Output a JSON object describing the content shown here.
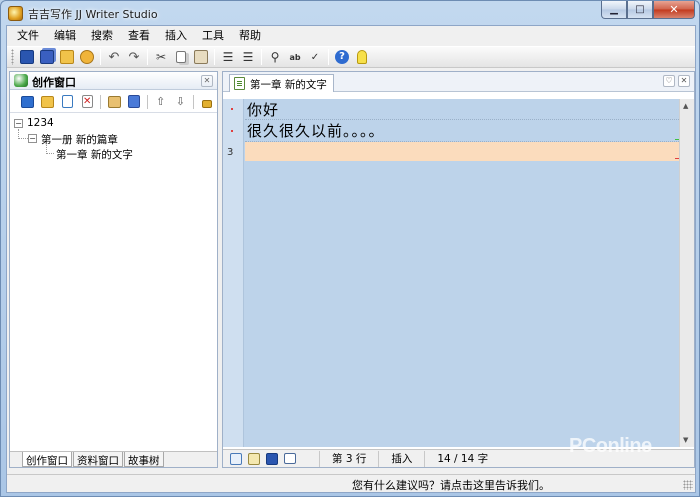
{
  "window": {
    "title": "吉吉写作 JJ Writer Studio",
    "controls": {
      "minimize": "▁",
      "maximize": "□",
      "close": "✕"
    }
  },
  "menu": [
    {
      "label": "文件"
    },
    {
      "label": "编辑"
    },
    {
      "label": "搜索"
    },
    {
      "label": "查看"
    },
    {
      "label": "插入"
    },
    {
      "label": "工具"
    },
    {
      "label": "帮助"
    }
  ],
  "toolbar": {
    "groups": [
      [
        "save-icon",
        "save-all-icon",
        "open-folder-icon",
        "open-recent-icon"
      ],
      [
        "undo-icon",
        "redo-icon"
      ],
      [
        "cut-icon",
        "copy-icon",
        "paste-icon"
      ],
      [
        "indent-icon",
        "outdent-icon"
      ],
      [
        "find-icon",
        "replace-icon",
        "spell-check-icon"
      ],
      [
        "help-icon",
        "tip-icon"
      ]
    ]
  },
  "left_panel": {
    "title": "创作窗口",
    "close": "✕",
    "tools": [
      "new-book-icon",
      "new-chapter-icon",
      "new-doc-icon",
      "delete-icon",
      "properties-icon",
      "notes-icon",
      "move-up-icon",
      "move-down-icon",
      "lock-icon"
    ],
    "tree": {
      "root": "1234",
      "volume": "第一册 新的篇章",
      "chapter": "第一章 新的文字"
    },
    "tabs": [
      "创作窗口",
      "资料窗口",
      "故事树"
    ]
  },
  "document": {
    "tab_label": "第一章 新的文字",
    "lines": [
      "你好",
      "很久很久以前。。。。"
    ],
    "current_line_number": "3",
    "status": {
      "line": "第 3 行",
      "mode": "插入",
      "count": "14 / 14 字"
    }
  },
  "statusbar": {
    "suggest": "您有什么建议吗？请点击这里告诉我们。"
  },
  "watermark": "PConline",
  "colors": {
    "editor_bg": "#bdd3ea",
    "current_line": "#fbdcbd",
    "title_bar": "#c2d8ef",
    "close_button": "#c2381c"
  }
}
